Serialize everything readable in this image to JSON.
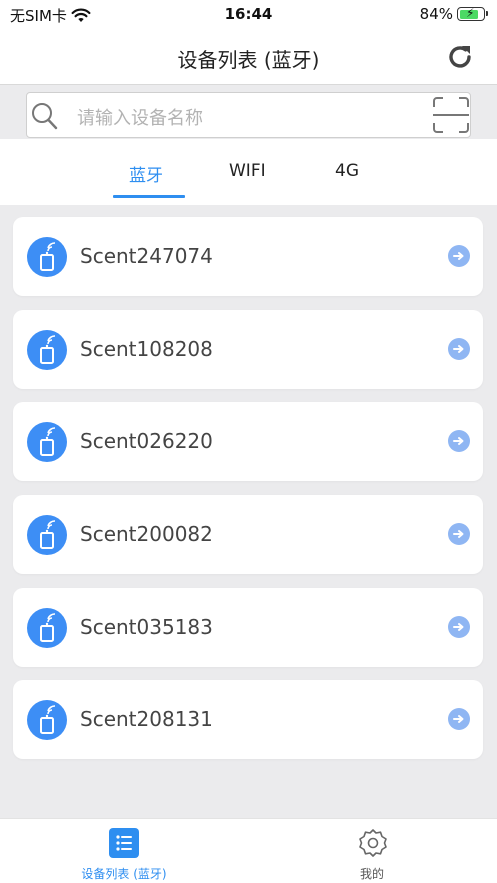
{
  "status_bar": {
    "carrier": "无SIM卡",
    "time": "16:44",
    "battery": "84%",
    "battery_level": 0.84,
    "icons": [
      "wifi-icon",
      "battery-charging-icon"
    ]
  },
  "navbar": {
    "title": "设备列表 (蓝牙)",
    "refresh_icon": "refresh-icon"
  },
  "search": {
    "placeholder": "请输入设备名称",
    "icon": "search-icon",
    "scan_icon": "scan-icon"
  },
  "tabs": [
    {
      "label": "蓝牙",
      "active": true
    },
    {
      "label": "WIFI",
      "active": false
    },
    {
      "label": "4G",
      "active": false
    }
  ],
  "devices": [
    {
      "name": "Scent247074"
    },
    {
      "name": "Scent108208"
    },
    {
      "name": "Scent026220"
    },
    {
      "name": "Scent200082"
    },
    {
      "name": "Scent035183"
    },
    {
      "name": "Scent208131"
    }
  ],
  "tabbar": {
    "items": [
      {
        "label": "设备列表 (蓝牙)",
        "icon": "list-icon",
        "active": true
      },
      {
        "label": "我的",
        "icon": "gear-icon",
        "active": false
      }
    ]
  },
  "colors": {
    "accent": "#2e8ef0",
    "device_icon": "#3d8ef5",
    "arrow": "#8fb6f3",
    "background": "#ebebed"
  }
}
